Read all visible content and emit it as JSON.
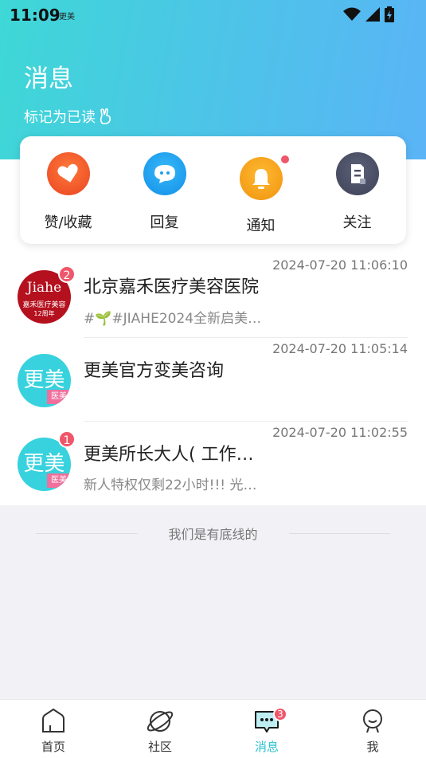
{
  "status_bar": {
    "time": "11:09",
    "app_label": "更美"
  },
  "header": {
    "title": "消息",
    "mark_read": "标记为已读"
  },
  "quick_actions": [
    {
      "label": "赞/收藏",
      "icon": "heart-icon",
      "color": "#f15a2c"
    },
    {
      "label": "回复",
      "icon": "chat-bubble-icon",
      "color": "#1e9fef"
    },
    {
      "label": "通知",
      "icon": "bell-icon",
      "color": "#f7a21b",
      "has_dot": true
    },
    {
      "label": "关注",
      "icon": "document-icon",
      "color": "#4c5068"
    }
  ],
  "messages": [
    {
      "name": "北京嘉禾医疗美容医院",
      "time": "2024-07-20  11:06:10",
      "preview": "#🌱#JIAHE2024全新启美…",
      "badge": "2",
      "avatar_text": "Jiahe",
      "avatar_sub": "嘉禾医疗美容",
      "avatar_sub2": "12周年"
    },
    {
      "name": "更美官方变美咨询",
      "time": "2024-07-20  11:05:14",
      "preview": "",
      "badge": "",
      "avatar_text": "更美",
      "avatar_sub": "医美"
    },
    {
      "name": "更美所长大人( 工作…",
      "time": "2024-07-20  11:02:55",
      "preview": "新人特权仅剩22小时!!! 光…",
      "badge": "1",
      "avatar_text": "更美",
      "avatar_sub": "医美"
    }
  ],
  "footer_note": "我们是有底线的",
  "bottom_nav": [
    {
      "label": "首页",
      "icon": "home-icon"
    },
    {
      "label": "社区",
      "icon": "planet-icon"
    },
    {
      "label": "消息",
      "icon": "message-icon",
      "active": true,
      "badge": "3"
    },
    {
      "label": "我",
      "icon": "profile-icon"
    }
  ],
  "colors": {
    "accent": "#2cc3cf",
    "badge": "#f0566a",
    "gradient_start": "#3ed8d6",
    "gradient_end": "#5ab4f6"
  }
}
